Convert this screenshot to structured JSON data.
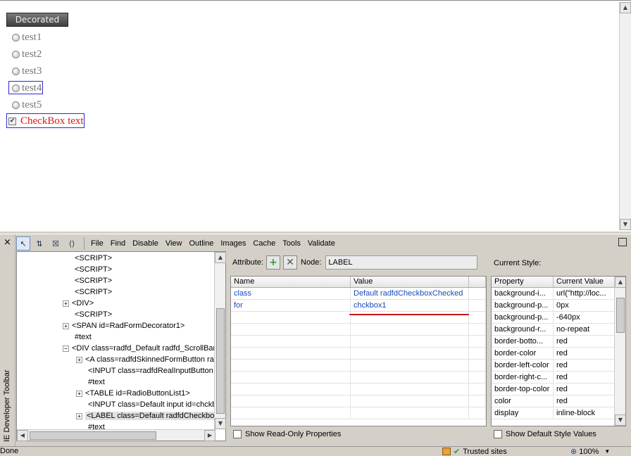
{
  "page": {
    "decorated_button": "Decorated",
    "radios": [
      "test1",
      "test2",
      "test3",
      "test4",
      "test5"
    ],
    "checkbox_label": "CheckBox text",
    "checkbox_glyph": "✔"
  },
  "devtoolbar": {
    "title": "IE Developer Toolbar",
    "close": "×",
    "menu": [
      "File",
      "Find",
      "Disable",
      "View",
      "Outline",
      "Images",
      "Cache",
      "Tools",
      "Validate"
    ],
    "tree": [
      {
        "label": "<SCRIPT>",
        "expander": ""
      },
      {
        "label": "<SCRIPT>",
        "expander": ""
      },
      {
        "label": "<SCRIPT>",
        "expander": ""
      },
      {
        "label": "<SCRIPT>",
        "expander": ""
      },
      {
        "label": "<DIV>",
        "expander": "+"
      },
      {
        "label": "<SCRIPT>",
        "expander": ""
      },
      {
        "label": "<SPAN id=RadFormDecorator1>",
        "expander": "+"
      },
      {
        "label": "#text",
        "expander": ""
      },
      {
        "label": "<DIV class=radfd_Default radfd_ScrollBar",
        "expander": "−"
      },
      {
        "label": "<A class=radfdSkinnedFormButton ra",
        "expander": "+"
      },
      {
        "label": "<INPUT class=radfdRealInputButton",
        "expander": ""
      },
      {
        "label": "#text",
        "expander": ""
      },
      {
        "label": "<TABLE id=RadioButtonList1>",
        "expander": "+"
      },
      {
        "label": "<INPUT class=Default input id=chckb",
        "expander": ""
      },
      {
        "label": "<LABEL class=Default radfdCheckbox",
        "expander": "+"
      },
      {
        "label": "#text",
        "expander": ""
      }
    ],
    "attributes": {
      "attribute_label": "Attribute:",
      "node_label": "Node:",
      "node_value": "LABEL",
      "columns": [
        "Name",
        "Value"
      ],
      "rows": [
        {
          "name": "class",
          "value": "Default radfdCheckboxChecked"
        },
        {
          "name": "for",
          "value": "chckbox1"
        }
      ],
      "show_readonly": "Show Read-Only Properties"
    },
    "current_style": {
      "title": "Current Style:",
      "columns": [
        "Property",
        "Current Value"
      ],
      "rows": [
        {
          "prop": "background-i...",
          "value": "url(\"http://loc..."
        },
        {
          "prop": "background-p...",
          "value": "0px"
        },
        {
          "prop": "background-p...",
          "value": "-640px"
        },
        {
          "prop": "background-r...",
          "value": "no-repeat"
        },
        {
          "prop": "border-botto...",
          "value": "red"
        },
        {
          "prop": "border-color",
          "value": "red"
        },
        {
          "prop": "border-left-color",
          "value": "red"
        },
        {
          "prop": "border-right-c...",
          "value": "red"
        },
        {
          "prop": "border-top-color",
          "value": "red"
        },
        {
          "prop": "color",
          "value": "red"
        },
        {
          "prop": "display",
          "value": "inline-block"
        }
      ],
      "show_default": "Show Default Style Values"
    }
  },
  "statusbar": {
    "done": "Done",
    "zone": "Trusted sites",
    "zoom": "100%"
  },
  "colors": {
    "checkbox_text": "#e01414",
    "focus_border": "#2a2ad8",
    "attr_value": "#1a4bb5",
    "underline": "#c21818"
  }
}
